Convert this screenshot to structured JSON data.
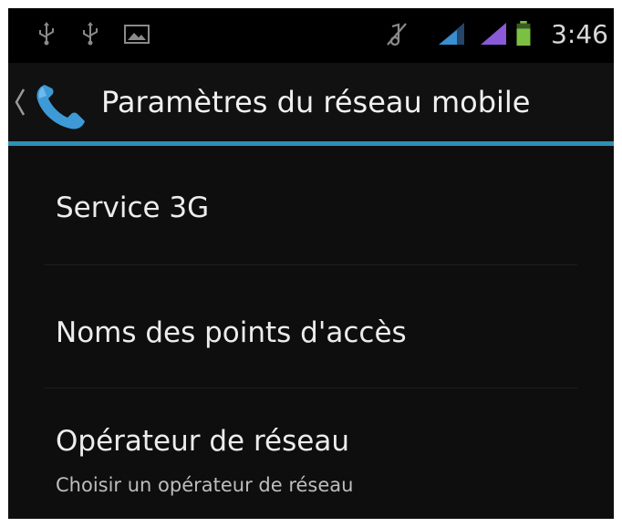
{
  "status_bar": {
    "time": "3:46",
    "left_icons": [
      "usb-icon",
      "usb-icon",
      "image-icon"
    ],
    "right_icons": [
      "mute-icon",
      "signal-icon",
      "signal-icon",
      "battery-icon"
    ],
    "colors": {
      "signal_1": "#3a8fd0",
      "signal_2": "#8a5ad8",
      "battery": "#7bc043"
    }
  },
  "action_bar": {
    "title": "Paramètres du réseau mobile",
    "icon": "phone-icon",
    "accent": "#2f8fb5"
  },
  "items": [
    {
      "title": "Service 3G",
      "subtitle": ""
    },
    {
      "title": "Noms des points d'accès",
      "subtitle": ""
    },
    {
      "title": "Opérateur de réseau",
      "subtitle": "Choisir un opérateur de réseau"
    }
  ]
}
